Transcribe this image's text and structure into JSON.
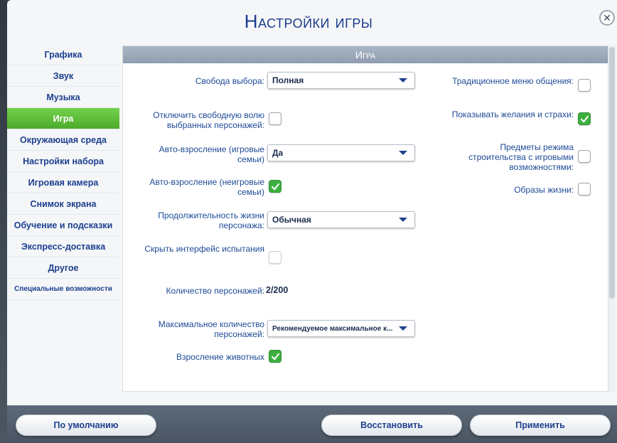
{
  "window": {
    "title": "Настройки игры"
  },
  "sidebar": {
    "items": [
      {
        "label": "Графика"
      },
      {
        "label": "Звук"
      },
      {
        "label": "Музыка"
      },
      {
        "label": "Игра",
        "active": true
      },
      {
        "label": "Окружающая среда"
      },
      {
        "label": "Настройки набора"
      },
      {
        "label": "Игровая камера"
      },
      {
        "label": "Снимок экрана"
      },
      {
        "label": "Обучение и подсказки"
      },
      {
        "label": "Экспресс-доставка"
      },
      {
        "label": "Другое"
      },
      {
        "label": "Специальные возможности"
      }
    ]
  },
  "panel": {
    "header": "Игра",
    "left": {
      "free_will_label": "Свобода выбора:",
      "free_will_value": "Полная",
      "disable_free_will_label": "Отключить свободную волю выбранных персонажей:",
      "aging_played_label": "Авто-взросление (игровые семьи)",
      "aging_played_value": "Да",
      "aging_unplayed_label": "Авто-взросление (неигровые семьи)",
      "lifespan_label": "Продолжительность жизни персонажа:",
      "lifespan_value": "Обычная",
      "hide_challenge_ui_label": "Скрыть интерфейс испытания",
      "sim_count_label": "Количество персонажей:",
      "sim_count_value": "2/200",
      "max_sims_label": "Максимальное количество персонажей:",
      "max_sims_value": "Рекомендуемое максимальное к...",
      "pet_aging_label": "Взросление животных"
    },
    "right": {
      "social_menu_label": "Традиционное меню общения:",
      "wants_fears_label": "Показывать желания и страхи:",
      "build_items_label": "Предметы режима строительства с игровыми возможностями:",
      "lifestyles_label": "Образы жизни:"
    },
    "checkboxes": {
      "disable_free_will": false,
      "aging_unplayed": true,
      "hide_challenge_ui": false,
      "pet_aging": true,
      "social_menu": false,
      "wants_fears": true,
      "build_items": false,
      "lifestyles": false
    }
  },
  "buttons": {
    "defaults": "По умолчанию",
    "restore": "Восстановить",
    "apply": "Применить"
  },
  "colors": {
    "accent_green": "#5bc236",
    "title_blue": "#1a3a8c",
    "label_blue": "#1d4a96"
  },
  "icons": {
    "close": "close-icon",
    "dropdown": "chevron-down-icon",
    "check": "checkmark-icon"
  }
}
